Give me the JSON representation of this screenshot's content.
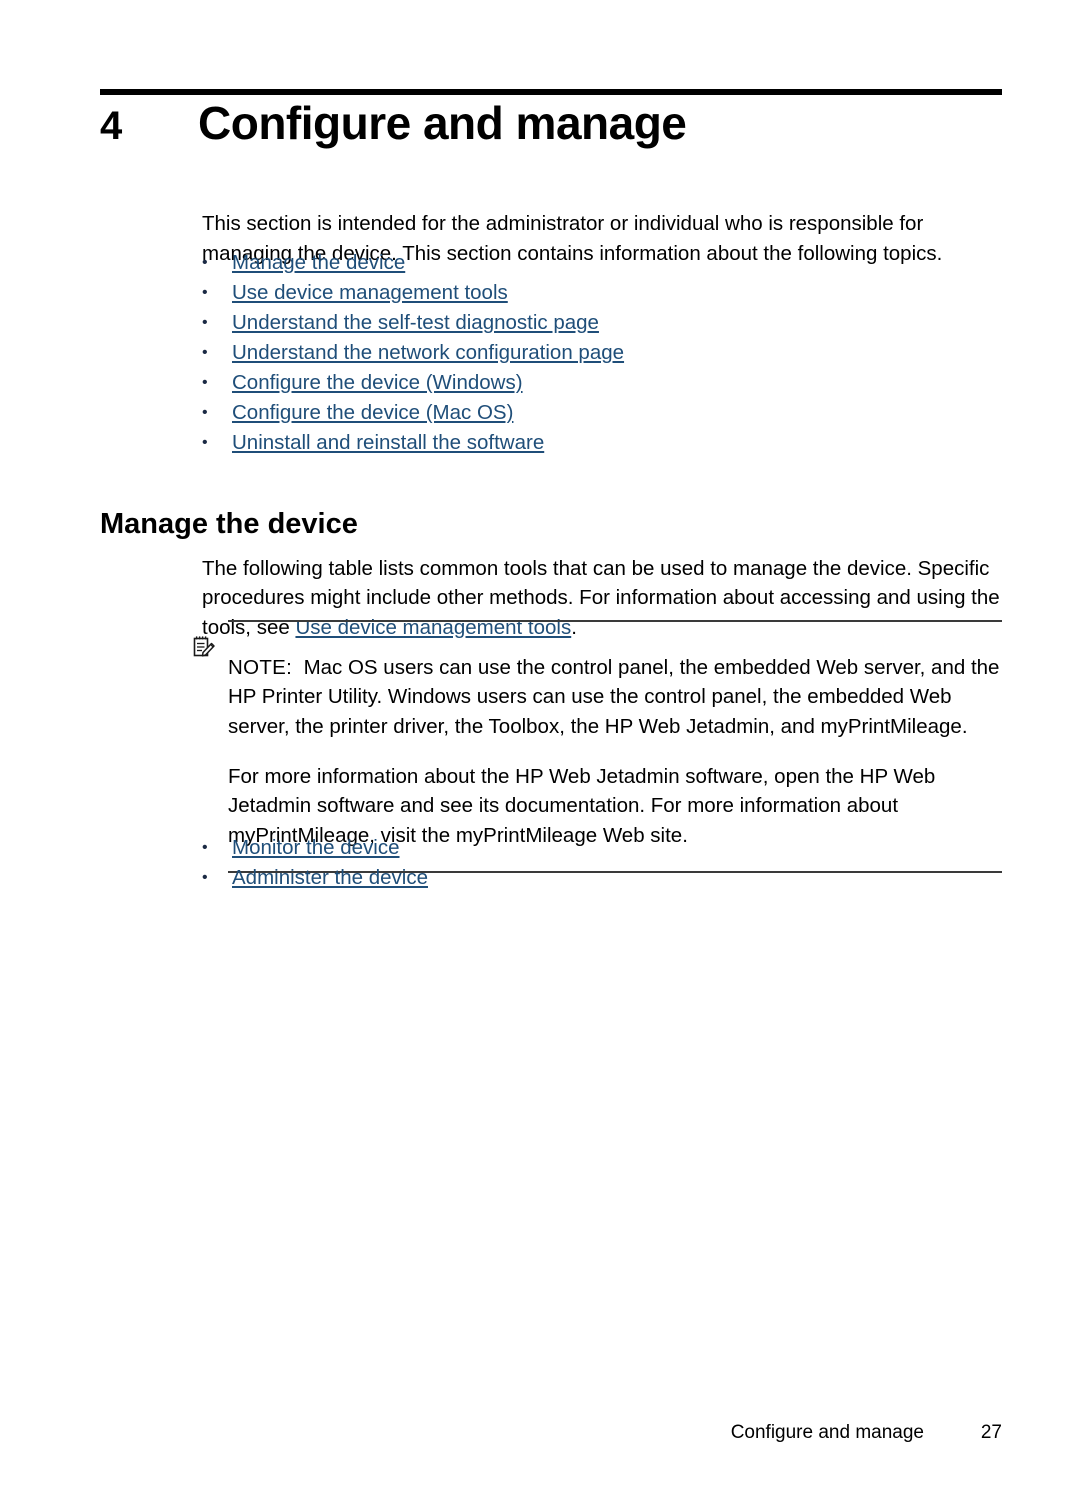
{
  "chapter": {
    "number": "4",
    "title": "Configure and manage"
  },
  "intro": "This section is intended for the administrator or individual who is responsible for managing the device. This section contains information about the following topics.",
  "toc_links": [
    {
      "label": "Manage the device"
    },
    {
      "label": "Use device management tools"
    },
    {
      "label": "Understand the self-test diagnostic page"
    },
    {
      "label": "Understand the network configuration page"
    },
    {
      "label": "Configure the device (Windows)"
    },
    {
      "label": "Configure the device (Mac OS)"
    },
    {
      "label": "Uninstall and reinstall the software"
    }
  ],
  "section": {
    "heading": "Manage the device",
    "para_before_link": "The following table lists common tools that can be used to manage the device. Specific procedures might include other methods. For information about accessing and using the tools, see ",
    "para_link": "Use device management tools",
    "para_after_link": "."
  },
  "note": {
    "icon": "note-pad-pencil-icon",
    "label": "NOTE:",
    "paragraph_1": "Mac OS users can use the control panel, the embedded Web server, and the HP Printer Utility. Windows users can use the control panel, the embedded Web server, the printer driver, the Toolbox, the HP Web Jetadmin, and myPrintMileage.",
    "paragraph_2": "For more information about the HP Web Jetadmin software, open the HP Web Jetadmin software and see its documentation. For more information about myPrintMileage, visit the myPrintMileage Web site."
  },
  "post_links": [
    {
      "label": "Monitor the device"
    },
    {
      "label": "Administer the device"
    }
  ],
  "footer": {
    "title": "Configure and manage",
    "page_number": "27"
  },
  "colors": {
    "link": "#1f4e79",
    "text": "#000000",
    "rule": "#000000",
    "note_rule": "#3a3a3a"
  }
}
